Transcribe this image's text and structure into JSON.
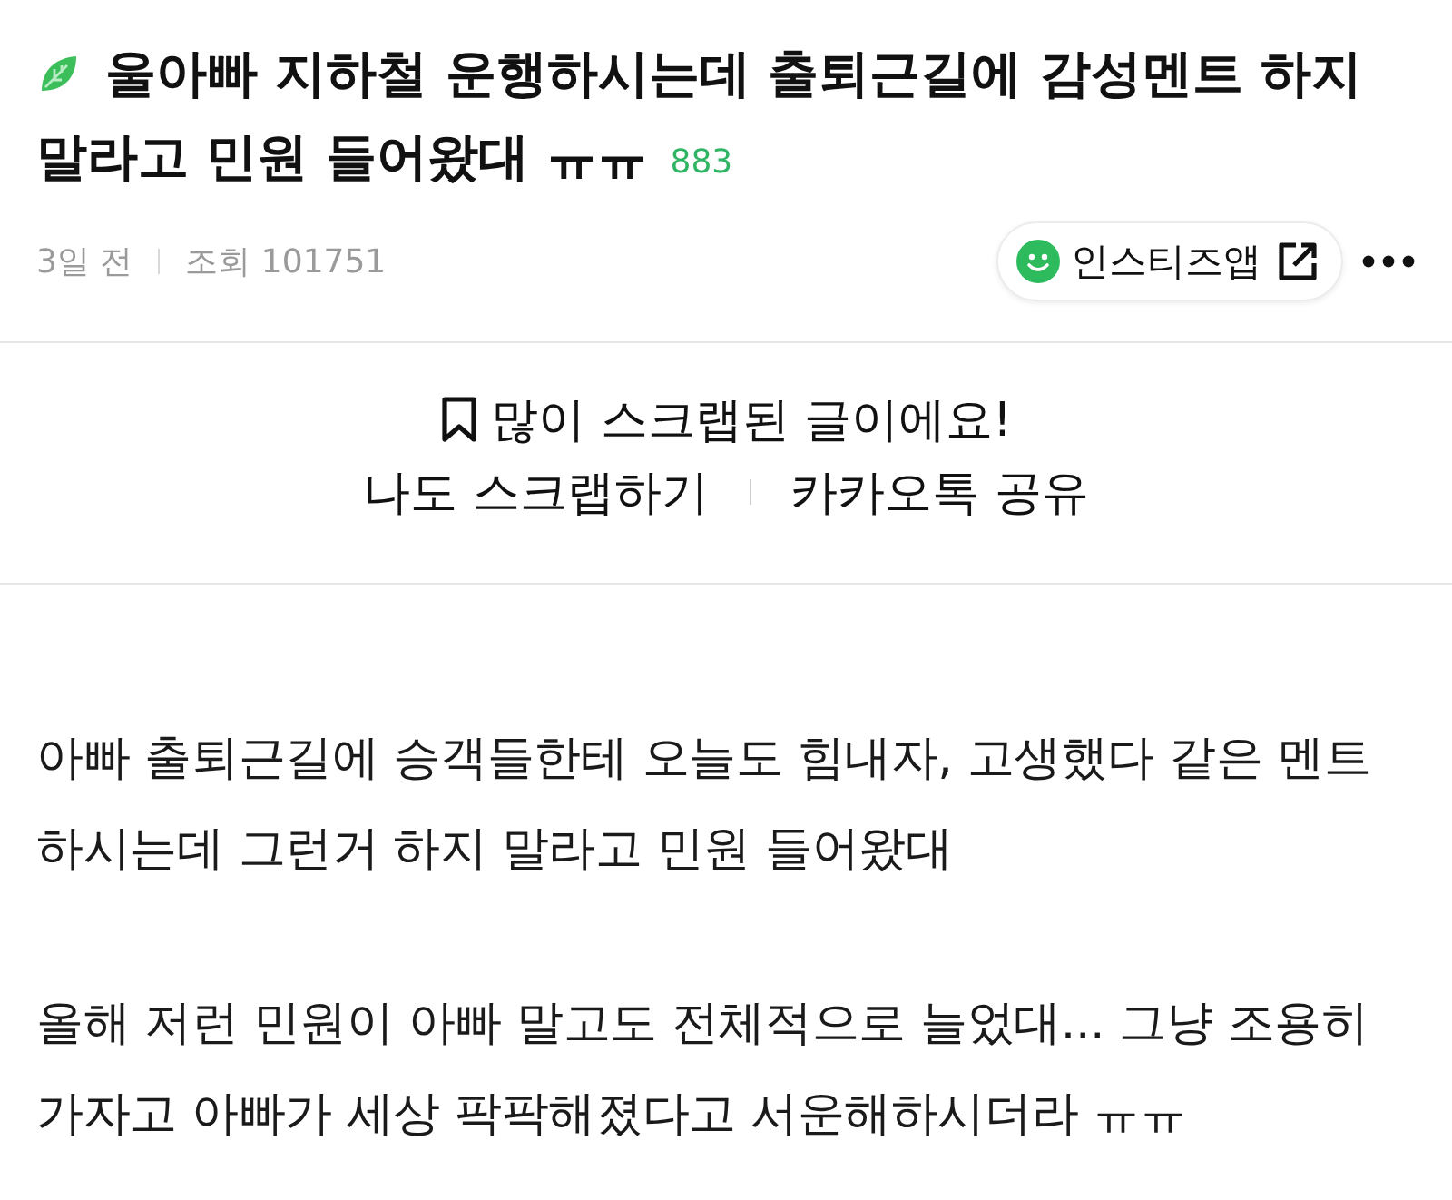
{
  "post": {
    "title_lines": [
      "울아빠 지하철 운행하시는데 출퇴근길에 감성멘트 하지",
      "말라고 민원 들어왔대 ㅠㅠ"
    ],
    "comment_count": "883"
  },
  "meta": {
    "time": "3일 전",
    "views": "조회 101751",
    "app_button": "인스티즈앱"
  },
  "scrap": {
    "notice": "많이 스크랩된 글이에요!",
    "actions": [
      "나도 스크랩하기",
      "카카오톡 공유"
    ]
  },
  "body": {
    "paragraphs": [
      "아빠 출퇴근길에 승객들한테 오늘도 힘내자, 고생했다 같은 멘트 하시는데 그런거 하지 말라고 민원 들어왔대",
      "올해 저런 민원이 아빠 말고도 전체적으로 늘었대... 그냥 조용히 가자고 아빠가 세상 팍팍해졌다고 서운해하시더라 ㅠㅠ"
    ]
  }
}
